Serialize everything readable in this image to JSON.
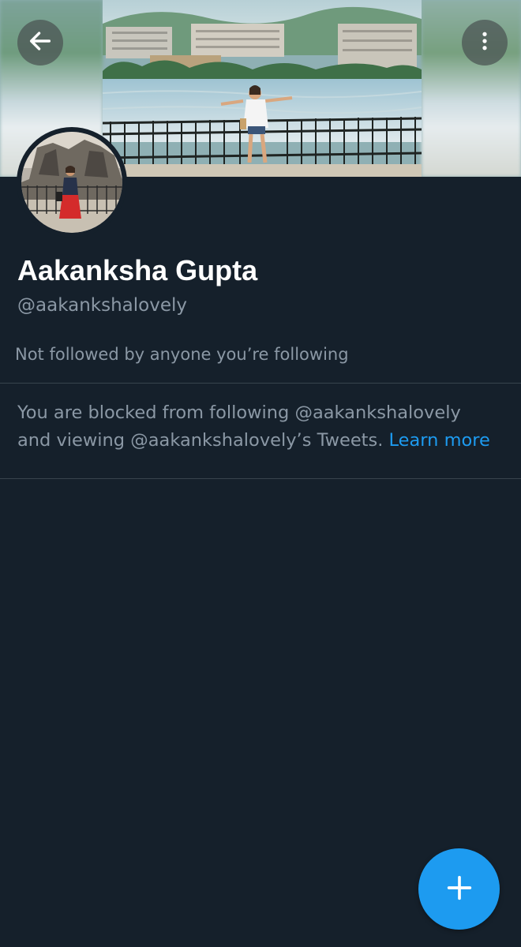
{
  "profile": {
    "display_name": "Aakanksha Gupta",
    "handle": "@aakankshalovely",
    "followers_note": "Not followed by anyone you’re following"
  },
  "blocked_notice": {
    "line1": "You are blocked from following @aakankshalovely",
    "line2": "and viewing @aakankshalovely’s Tweets.",
    "link_label": "Learn more"
  },
  "icons": {
    "back": "arrow-left-icon",
    "more": "vertical-ellipsis-icon",
    "compose": "plus-icon"
  },
  "colors": {
    "background": "#15202b",
    "text_primary": "#ffffff",
    "text_secondary": "#8b98a5",
    "accent": "#1d9bf0",
    "divider": "#38444d"
  }
}
